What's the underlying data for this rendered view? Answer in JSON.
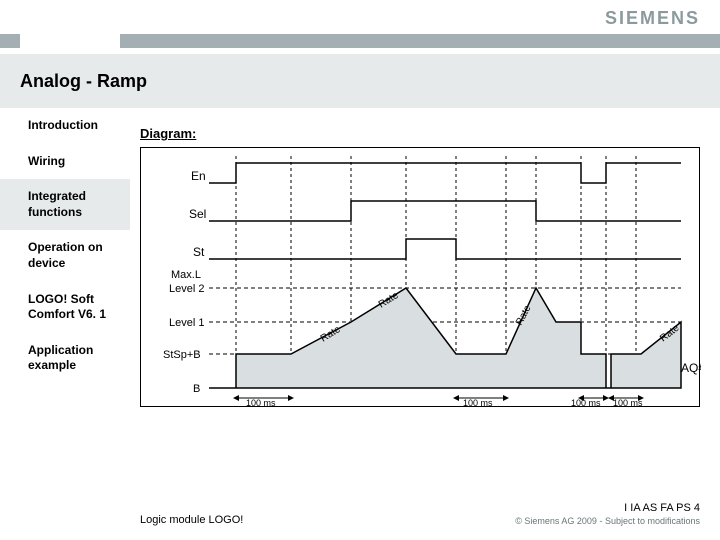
{
  "logo": "SIEMENS",
  "title": "Analog - Ramp",
  "sidebar": {
    "items": [
      {
        "label": "Introduction"
      },
      {
        "label": "Wiring"
      },
      {
        "label": "Integrated functions"
      },
      {
        "label": "Operation on device"
      },
      {
        "label": "LOGO! Soft Comfort V6. 1"
      },
      {
        "label": "Application example"
      }
    ],
    "active_index": 2
  },
  "diagram": {
    "label": "Diagram:",
    "rows": [
      {
        "name": "En"
      },
      {
        "name": "Sel"
      },
      {
        "name": "St"
      }
    ],
    "levels": {
      "maxL": "Max.L",
      "level2": "Level 2",
      "level1": "Level 1",
      "stspb": "StSp+B",
      "b": "B"
    },
    "output": "AQ#",
    "ramp_label": "Rate",
    "time_label": "100 ms",
    "timing_instances": 4
  },
  "footer": {
    "left": "Logic module LOGO!",
    "right": "I IA AS FA PS 4",
    "copyright": "© Siemens AG 2009 - Subject to modifications"
  },
  "chart_data": {
    "type": "timing-diagram",
    "signals": [
      {
        "name": "En",
        "transitions": [
          [
            0,
            0
          ],
          [
            1,
            0
          ],
          [
            1,
            1
          ],
          [
            8.2,
            1
          ],
          [
            8.2,
            0
          ],
          [
            8.7,
            0
          ],
          [
            8.7,
            1
          ],
          [
            10,
            1
          ]
        ]
      },
      {
        "name": "Sel",
        "transitions": [
          [
            0,
            0
          ],
          [
            3.1,
            0
          ],
          [
            3.1,
            1
          ],
          [
            7,
            1
          ],
          [
            7,
            0
          ],
          [
            10,
            0
          ]
        ]
      },
      {
        "name": "St",
        "transitions": [
          [
            0,
            0
          ],
          [
            4.6,
            0
          ],
          [
            4.6,
            1
          ],
          [
            5.5,
            1
          ],
          [
            5.5,
            0
          ],
          [
            10,
            0
          ]
        ]
      }
    ],
    "analog": {
      "name": "AQ#",
      "y_levels": {
        "B": 0,
        "StSp+B": 1,
        "Level 1": 2,
        "Level 2": 3,
        "Max.L": 3.3
      },
      "segments": [
        {
          "from": [
            0,
            0
          ],
          "to": [
            0,
            0
          ]
        },
        {
          "from": [
            1,
            0
          ],
          "to": [
            1,
            1
          ],
          "vertical": true
        },
        {
          "from": [
            1,
            1
          ],
          "to": [
            2,
            1
          ],
          "label_below": "100 ms"
        },
        {
          "from": [
            2,
            1
          ],
          "to": [
            3.1,
            2
          ],
          "label": "Rate"
        },
        {
          "from": [
            3.1,
            2
          ],
          "to": [
            4.1,
            3
          ],
          "label": "Rate"
        },
        {
          "from": [
            4.1,
            3
          ],
          "to": [
            4.6,
            3
          ]
        },
        {
          "from": [
            4.6,
            3
          ],
          "to": [
            5.5,
            1
          ],
          "vertical": false
        },
        {
          "from": [
            5.5,
            1
          ],
          "to": [
            6.5,
            1
          ],
          "label_below": "100 ms"
        },
        {
          "from": [
            6.5,
            1
          ],
          "to": [
            7,
            3
          ],
          "label": "Rate"
        },
        {
          "from": [
            7,
            3
          ],
          "to": [
            7.5,
            2
          ]
        },
        {
          "from": [
            7.5,
            2
          ],
          "to": [
            8.2,
            2
          ]
        },
        {
          "from": [
            8.2,
            2
          ],
          "to": [
            8.2,
            1
          ],
          "vertical": true
        },
        {
          "from": [
            8.2,
            1
          ],
          "to": [
            8.7,
            1
          ],
          "label_below": "100 ms"
        },
        {
          "from": [
            8.7,
            1
          ],
          "to": [
            8.7,
            0
          ],
          "vertical": true
        },
        {
          "from": [
            8.7,
            0
          ],
          "to": [
            8.8,
            0
          ]
        },
        {
          "from": [
            8.8,
            0
          ],
          "to": [
            8.8,
            1
          ]
        },
        {
          "from": [
            8.8,
            1
          ],
          "to": [
            9.4,
            1
          ],
          "label_below": "100 ms"
        },
        {
          "from": [
            9.4,
            1
          ],
          "to": [
            10,
            2
          ],
          "label": "Rate"
        }
      ]
    }
  }
}
